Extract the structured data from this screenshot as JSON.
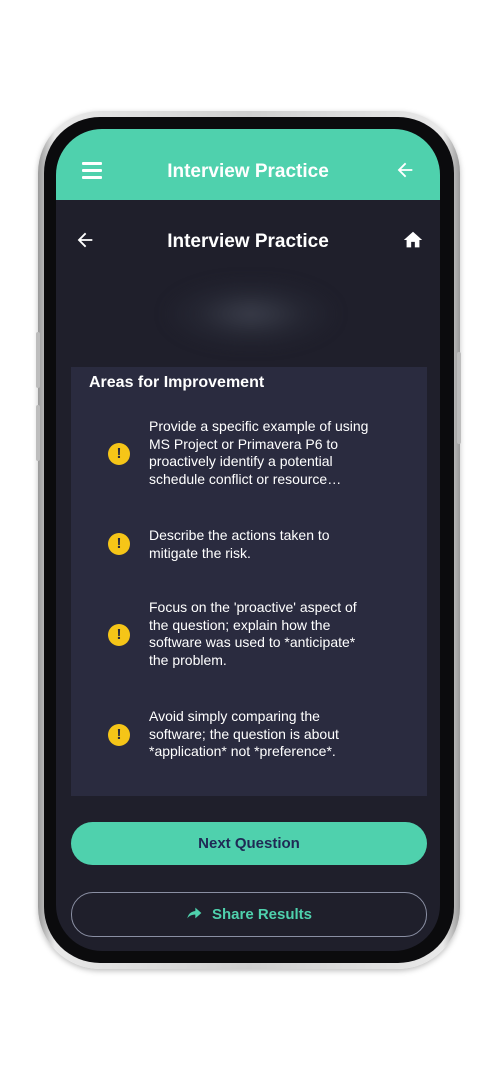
{
  "app_bar": {
    "title": "Interview Practice",
    "menu_icon": "hamburger-menu-icon",
    "back_icon": "arrow-left-icon",
    "color": "#4fd1ad"
  },
  "sub_header": {
    "title": "Interview Practice",
    "back_icon": "arrow-left-icon",
    "home_icon": "home-icon"
  },
  "improvements": {
    "title": "Areas for Improvement",
    "icon": "warning-icon",
    "icon_glyph": "!",
    "icon_color": "#f5c518",
    "items": [
      {
        "text": "Provide a specific example of using MS Project or Primavera P6 to proactively identify a potential schedule conflict or resource constraint."
      },
      {
        "text": "Describe the actions taken to mitigate the risk."
      },
      {
        "text": "Focus on the 'proactive' aspect of the question; explain how the software was used to *anticipate* the problem."
      },
      {
        "text": "Avoid simply comparing the software; the question is about *application* not *preference*."
      }
    ]
  },
  "actions": {
    "next_label": "Next Question",
    "share_label": "Share Results",
    "share_icon": "share-arrow-icon"
  }
}
